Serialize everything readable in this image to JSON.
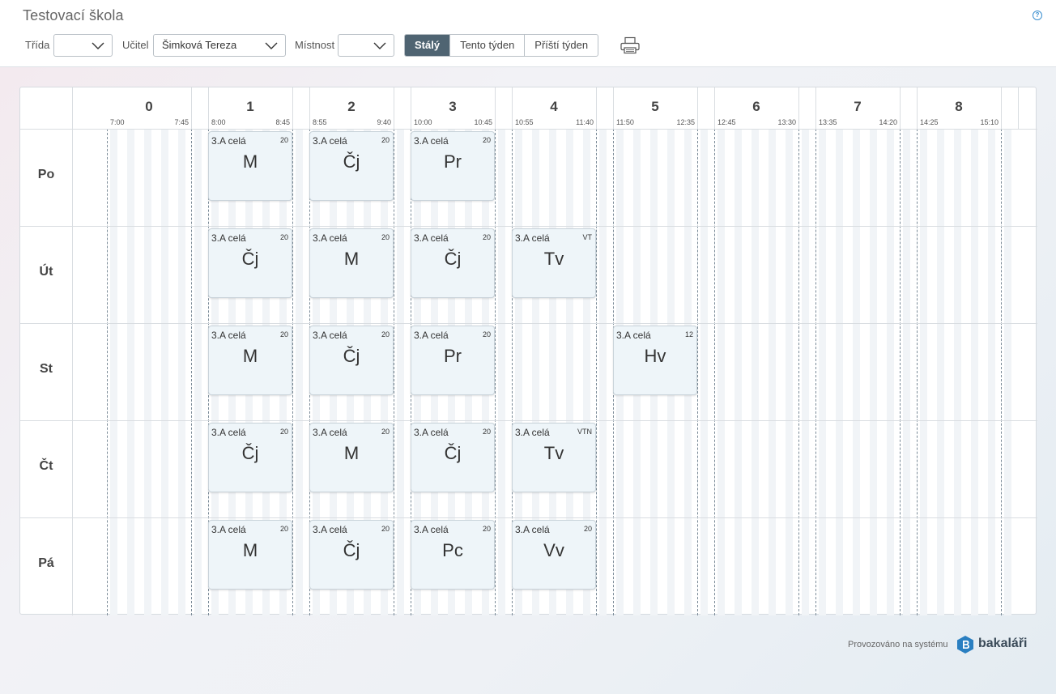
{
  "header": {
    "school_name": "Testovací škola",
    "help_icon": "?"
  },
  "filters": {
    "class_label": "Třída",
    "class_value": "",
    "teacher_label": "Učitel",
    "teacher_value": "Šimková Tereza",
    "room_label": "Místnost",
    "room_value": ""
  },
  "view_modes": [
    {
      "label": "Stálý",
      "active": true
    },
    {
      "label": "Tento týden",
      "active": false
    },
    {
      "label": "Příští týden",
      "active": false
    }
  ],
  "print_icon": "printer-icon",
  "periods": [
    {
      "num": "0",
      "start": "7:00",
      "end": "7:45"
    },
    {
      "num": "1",
      "start": "8:00",
      "end": "8:45"
    },
    {
      "num": "2",
      "start": "8:55",
      "end": "9:40"
    },
    {
      "num": "3",
      "start": "10:00",
      "end": "10:45"
    },
    {
      "num": "4",
      "start": "10:55",
      "end": "11:40"
    },
    {
      "num": "5",
      "start": "11:50",
      "end": "12:35"
    },
    {
      "num": "6",
      "start": "12:45",
      "end": "13:30"
    },
    {
      "num": "7",
      "start": "13:35",
      "end": "14:20"
    },
    {
      "num": "8",
      "start": "14:25",
      "end": "15:10"
    }
  ],
  "days": [
    {
      "name": "Po",
      "lessons": [
        {
          "period": 1,
          "group": "3.A celá",
          "room": "20",
          "subject": "M"
        },
        {
          "period": 2,
          "group": "3.A celá",
          "room": "20",
          "subject": "Čj"
        },
        {
          "period": 3,
          "group": "3.A celá",
          "room": "20",
          "subject": "Pr"
        }
      ]
    },
    {
      "name": "Út",
      "lessons": [
        {
          "period": 1,
          "group": "3.A celá",
          "room": "20",
          "subject": "Čj"
        },
        {
          "period": 2,
          "group": "3.A celá",
          "room": "20",
          "subject": "M"
        },
        {
          "period": 3,
          "group": "3.A celá",
          "room": "20",
          "subject": "Čj"
        },
        {
          "period": 4,
          "group": "3.A celá",
          "room": "VT",
          "subject": "Tv"
        }
      ]
    },
    {
      "name": "St",
      "lessons": [
        {
          "period": 1,
          "group": "3.A celá",
          "room": "20",
          "subject": "M"
        },
        {
          "period": 2,
          "group": "3.A celá",
          "room": "20",
          "subject": "Čj"
        },
        {
          "period": 3,
          "group": "3.A celá",
          "room": "20",
          "subject": "Pr"
        },
        {
          "period": 5,
          "group": "3.A celá",
          "room": "12",
          "subject": "Hv"
        }
      ]
    },
    {
      "name": "Čt",
      "lessons": [
        {
          "period": 1,
          "group": "3.A celá",
          "room": "20",
          "subject": "Čj"
        },
        {
          "period": 2,
          "group": "3.A celá",
          "room": "20",
          "subject": "M"
        },
        {
          "period": 3,
          "group": "3.A celá",
          "room": "20",
          "subject": "Čj"
        },
        {
          "period": 4,
          "group": "3.A celá",
          "room": "VTN",
          "subject": "Tv"
        }
      ]
    },
    {
      "name": "Pá",
      "lessons": [
        {
          "period": 1,
          "group": "3.A celá",
          "room": "20",
          "subject": "M"
        },
        {
          "period": 2,
          "group": "3.A celá",
          "room": "20",
          "subject": "Čj"
        },
        {
          "period": 3,
          "group": "3.A celá",
          "room": "20",
          "subject": "Pc"
        },
        {
          "period": 4,
          "group": "3.A celá",
          "room": "20",
          "subject": "Vv"
        }
      ]
    }
  ],
  "footer": {
    "text": "Provozováno na systému",
    "brand": "bakaláři"
  },
  "colors": {
    "active_tab": "#4f6472",
    "lesson_bg": "#eef5f9",
    "brand_blue": "#2a7fc1"
  }
}
